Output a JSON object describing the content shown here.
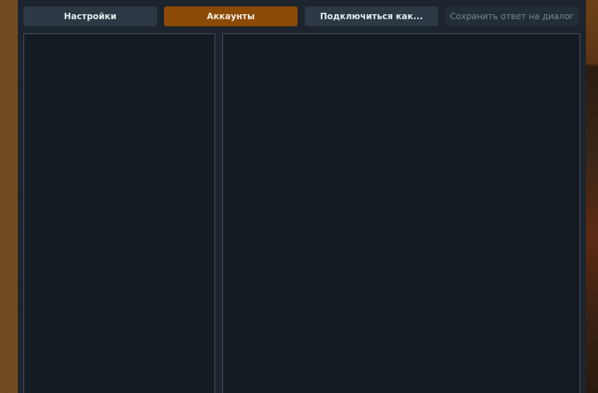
{
  "tabs": [
    {
      "id": "settings",
      "label": "Настройки",
      "state": "default"
    },
    {
      "id": "accounts",
      "label": "Аккаунты",
      "state": "active"
    },
    {
      "id": "connect-as",
      "label": "Подключиться как...",
      "state": "default"
    },
    {
      "id": "save-reply",
      "label": "Сохранить ответ на диалог",
      "state": "disabled"
    }
  ],
  "colors": {
    "window_bg": "#1c242d",
    "tab_default": "#2c3844",
    "tab_active": "#8b4a06",
    "tab_disabled": "#232d37",
    "panel_bg": "#151b23",
    "panel_border": "#4a5561"
  }
}
